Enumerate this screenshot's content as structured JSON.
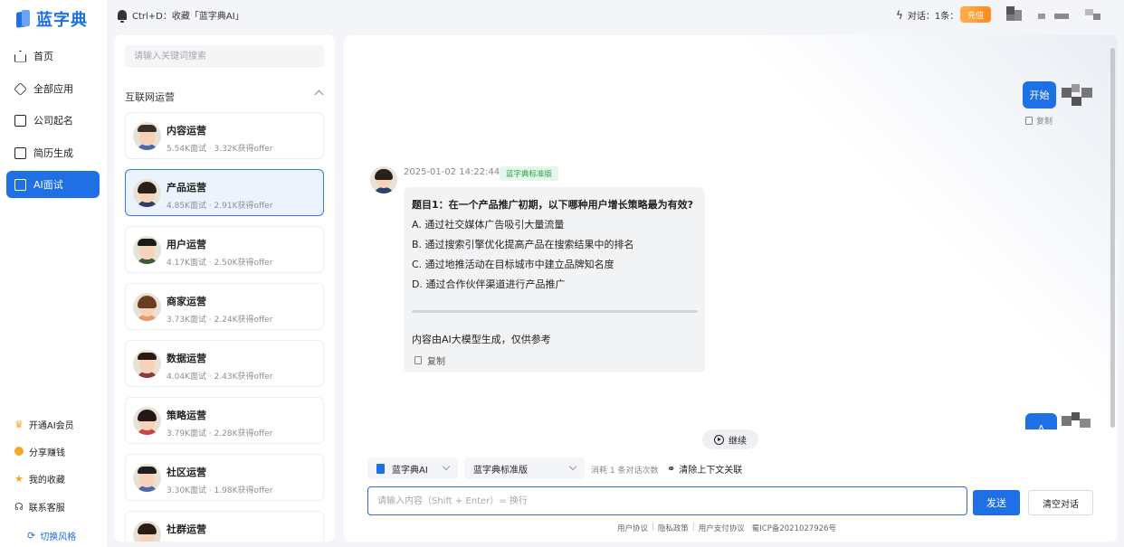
{
  "logo": {
    "text": "蓝字典"
  },
  "nav": {
    "items": [
      {
        "label": "首页",
        "icon": "home-icon"
      },
      {
        "label": "全部应用",
        "icon": "cube-icon"
      },
      {
        "label": "公司起名",
        "icon": "copy-icon"
      },
      {
        "label": "简历生成",
        "icon": "copy-icon"
      },
      {
        "label": "AI面试",
        "icon": "chat-icon",
        "active": true
      }
    ],
    "bottom": [
      {
        "label": "开通AI会员",
        "icon": "crown-icon",
        "color": "#f5a623"
      },
      {
        "label": "分享赚钱",
        "icon": "coin-icon",
        "color": "#f5a623"
      },
      {
        "label": "我的收藏",
        "icon": "star-icon",
        "color": "#f5a623"
      },
      {
        "label": "联系客服",
        "icon": "headset-icon",
        "color": "#444444"
      }
    ],
    "switch_style": "切换风格"
  },
  "topbar": {
    "bookmark_tip": "Ctrl+D：收藏「蓝字典AI」",
    "counter": "对话：1条：",
    "recharge": "充值"
  },
  "list": {
    "search_placeholder": "请输入关键词搜索",
    "group_title": "互联网运营",
    "cards": [
      {
        "name": "内容运营",
        "stats": "5.54K面试 · 3.32K获得offer"
      },
      {
        "name": "产品运营",
        "stats": "4.85K面试 · 2.91K获得offer"
      },
      {
        "name": "用户运营",
        "stats": "4.17K面试 · 2.50K获得offer"
      },
      {
        "name": "商家运营",
        "stats": "3.73K面试 · 2.24K获得offer"
      },
      {
        "name": "数据运营",
        "stats": "4.04K面试 · 2.43K获得offer"
      },
      {
        "name": "策略运营",
        "stats": "3.79K面试 · 2.28K获得offer"
      },
      {
        "name": "社区运营",
        "stats": "3.30K面试 · 1.98K获得offer"
      },
      {
        "name": "社群运营",
        "stats": ""
      }
    ]
  },
  "chat": {
    "user_msg": "开始",
    "copy": "复制",
    "bot_time": "2025-01-02 14:22:44",
    "bot_tag": "蓝字典标准版",
    "question": "题目1：在一个产品推广初期，以下哪种用户增长策略最为有效?",
    "options": [
      "A. 通过社交媒体广告吸引大量流量",
      "B. 通过搜索引擎优化提高产品在搜索结果中的排名",
      "C. 通过地推活动在目标城市中建立品牌知名度",
      "D. 通过合作伙伴渠道进行产品推广"
    ],
    "disclaimer": "内容由AI大模型生成，仅供参考",
    "bot_copy": "复制",
    "user_msg_2": "A",
    "continue": "继续",
    "model_select": "蓝字典AI",
    "version_select": "蓝字典标准版",
    "consume": "消耗 1 条对话次数",
    "clear_context": "清除上下文关联",
    "input_placeholder": "请输入内容（Shift + Enter）= 换行",
    "send": "发送",
    "clear_chat": "清空对话",
    "footer": [
      "用户协议",
      "隐私政策",
      "用户支付协议",
      "蜀ICP备2021027926号"
    ]
  }
}
